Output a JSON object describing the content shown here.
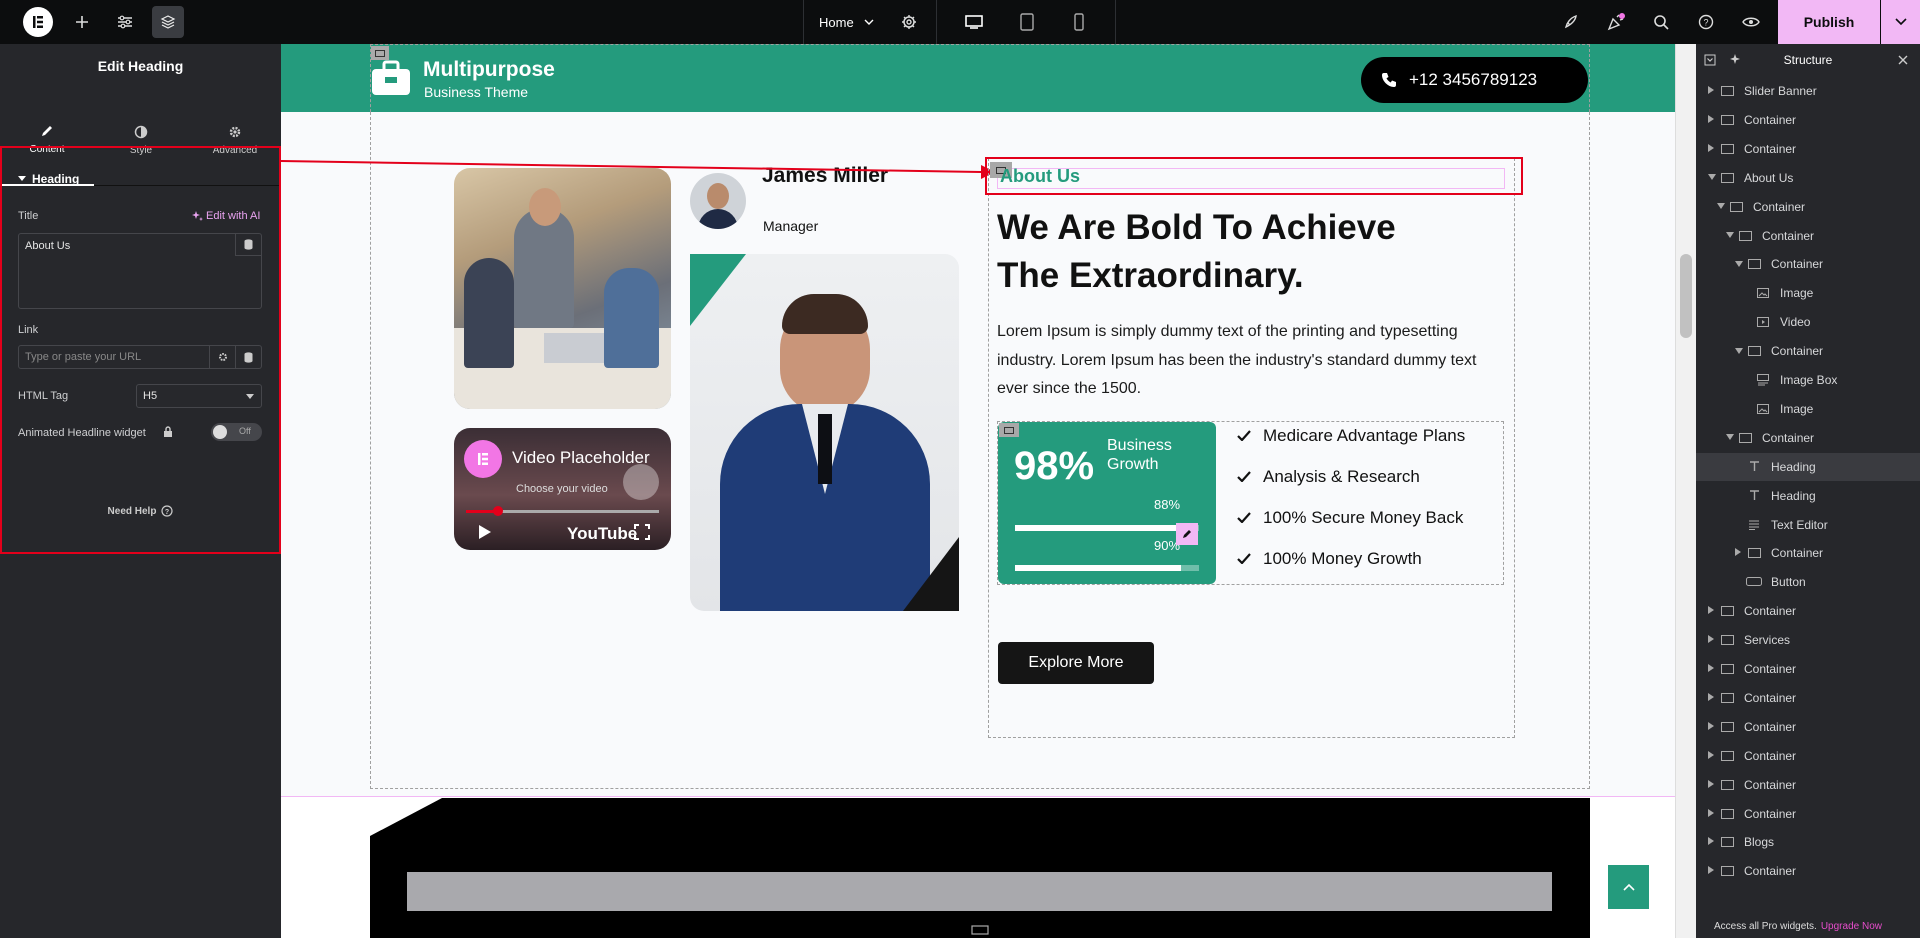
{
  "topbar": {
    "page_label": "Home",
    "publish_label": "Publish"
  },
  "left_panel": {
    "title": "Edit Heading",
    "tabs": [
      {
        "label": "Content",
        "icon": "pencil-icon"
      },
      {
        "label": "Style",
        "icon": "half-circle-icon"
      },
      {
        "label": "Advanced",
        "icon": "gear-icon"
      }
    ],
    "section_title": "Heading",
    "title_label": "Title",
    "edit_ai_label": "Edit with AI",
    "title_value": "About Us",
    "link_label": "Link",
    "link_placeholder": "Type or paste your URL",
    "html_tag_label": "HTML Tag",
    "html_tag_value": "H5",
    "animated_label": "Animated Headline widget",
    "toggle_label": "Off",
    "need_help": "Need Help"
  },
  "canvas": {
    "brand_name": "Multipurpose",
    "brand_sub": "Business Theme",
    "phone": "+12 3456789123",
    "person_name": "James Miller",
    "person_role": "Manager",
    "video_title": "Video Placeholder",
    "video_subtitle": "Choose your video",
    "youtube_label": "YouTube",
    "about_heading": "About Us",
    "main_heading": "We Are Bold To Achieve The Extraordinary.",
    "paragraph": "Lorem Ipsum is simply dummy text of the printing and typesetting industry. Lorem Ipsum has been the industry's standard dummy text ever since the 1500.",
    "growth_percent": "98%",
    "growth_label": "Business Growth",
    "bar1_label": "88%",
    "bar1_value": 0.88,
    "bar2_label": "90%",
    "bar2_value": 0.9,
    "features": [
      "Medicare Advantage Plans",
      "Analysis & Research",
      "100% Secure Money Back",
      "100% Money Growth"
    ],
    "explore_button": "Explore More"
  },
  "structure": {
    "title": "Structure",
    "items": [
      {
        "label": "Slider Banner"
      },
      {
        "label": "Container"
      },
      {
        "label": "Container"
      },
      {
        "label": "About Us"
      },
      {
        "label": "Container"
      },
      {
        "label": "Container"
      },
      {
        "label": "Container"
      },
      {
        "label": "Image"
      },
      {
        "label": "Video"
      },
      {
        "label": "Container"
      },
      {
        "label": "Image Box"
      },
      {
        "label": "Image"
      },
      {
        "label": "Container"
      },
      {
        "label": "Heading"
      },
      {
        "label": "Heading"
      },
      {
        "label": "Text Editor"
      },
      {
        "label": "Container"
      },
      {
        "label": "Button"
      },
      {
        "label": "Container"
      },
      {
        "label": "Services"
      },
      {
        "label": "Container"
      },
      {
        "label": "Container"
      },
      {
        "label": "Container"
      },
      {
        "label": "Container"
      },
      {
        "label": "Container"
      },
      {
        "label": "Container"
      },
      {
        "label": "Blogs"
      },
      {
        "label": "Container"
      }
    ],
    "footer_text": "Access all Pro widgets.",
    "footer_link": "Upgrade Now"
  },
  "colors": {
    "brand_green": "#249b7d",
    "publish_pink": "#f2b8f5",
    "highlight_red": "#e3001b"
  }
}
